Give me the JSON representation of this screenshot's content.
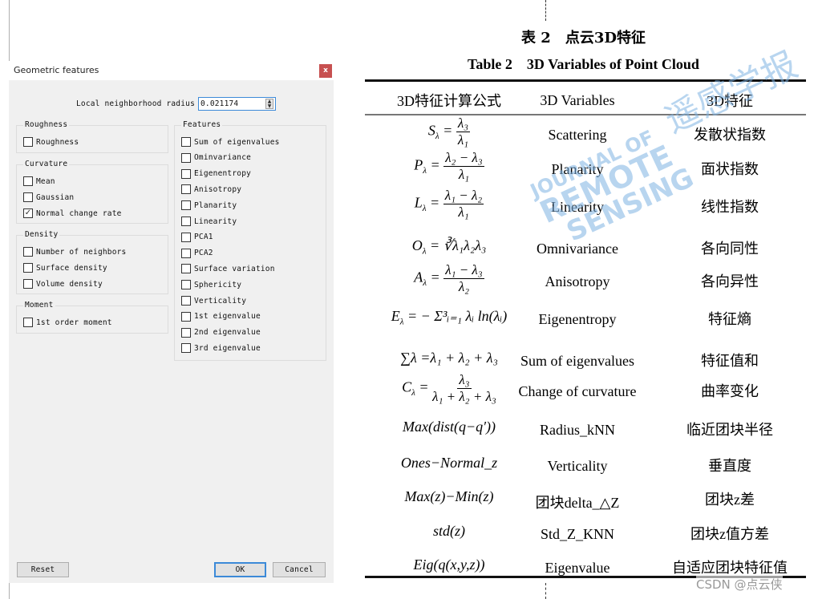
{
  "dialog": {
    "title": "Geometric features",
    "close_label": "x",
    "radius_label": "Local neighborhood radius",
    "radius_value": "0.021174",
    "groups": {
      "roughness": {
        "title": "Roughness",
        "items": [
          {
            "label": "Roughness",
            "checked": false
          }
        ]
      },
      "curvature": {
        "title": "Curvature",
        "items": [
          {
            "label": "Mean",
            "checked": false
          },
          {
            "label": "Gaussian",
            "checked": false
          },
          {
            "label": "Normal change rate",
            "checked": true
          }
        ]
      },
      "density": {
        "title": "Density",
        "items": [
          {
            "label": "Number of neighbors",
            "checked": false
          },
          {
            "label": "Surface density",
            "checked": false
          },
          {
            "label": "Volume density",
            "checked": false
          }
        ]
      },
      "moment": {
        "title": "Moment",
        "items": [
          {
            "label": "1st order moment",
            "checked": false
          }
        ]
      },
      "features": {
        "title": "Features",
        "items": [
          {
            "label": "Sum of eigenvalues",
            "checked": false
          },
          {
            "label": "Ominvariance",
            "checked": false
          },
          {
            "label": "Eigenentropy",
            "checked": false
          },
          {
            "label": "Anisotropy",
            "checked": false
          },
          {
            "label": "Planarity",
            "checked": false
          },
          {
            "label": "Linearity",
            "checked": false
          },
          {
            "label": "PCA1",
            "checked": false
          },
          {
            "label": "PCA2",
            "checked": false
          },
          {
            "label": "Surface variation",
            "checked": false
          },
          {
            "label": "Sphericity",
            "checked": false
          },
          {
            "label": "Verticality",
            "checked": false
          },
          {
            "label": "1st eigenvalue",
            "checked": false
          },
          {
            "label": "2nd eigenvalue",
            "checked": false
          },
          {
            "label": "3rd eigenvalue",
            "checked": false
          }
        ]
      }
    },
    "buttons": {
      "reset": "Reset",
      "ok": "OK",
      "cancel": "Cancel"
    }
  },
  "table": {
    "title_cn": "表 2　点云3D特征",
    "title_en": "Table 2　3D Variables of Point Cloud",
    "headers": [
      "3D特征计算公式",
      "3D Variables",
      "3D特征"
    ],
    "rows": [
      {
        "formula": "S_λ = λ3 / λ1",
        "f_lhs": "S",
        "f_num": "λ₃",
        "f_den": "λ₁",
        "variable": "Scattering",
        "cn": "发散状指数"
      },
      {
        "formula": "P_λ = (λ2 − λ3) / λ1",
        "f_lhs": "P",
        "f_num": "λ₂ − λ₃",
        "f_den": "λ₁",
        "variable": "Planarity",
        "cn": "面状指数"
      },
      {
        "formula": "L_λ = (λ1 − λ2) / λ1",
        "f_lhs": "L",
        "f_num": "λ₁ − λ₂",
        "f_den": "λ₁",
        "variable": "Linearity",
        "cn": "线性指数"
      },
      {
        "formula": "O_λ = ∛(λ1λ2λ3)",
        "f_text": "O",
        "f_rhs": "∛λ₁λ₂λ₃",
        "variable": "Omnivariance",
        "cn": "各向同性"
      },
      {
        "formula": "A_λ = (λ1 − λ3) / λ2",
        "f_lhs": "A",
        "f_num": "λ₁ − λ₃",
        "f_den": "λ₂",
        "variable": "Anisotropy",
        "cn": "各向异性"
      },
      {
        "formula": "E_λ = −Σ_{i=1}^{3} λi ln(λi)",
        "f_text": "E",
        "f_rhs": "− Σ³ᵢ₌₁ λᵢ ln(λᵢ)",
        "variable": "Eigenentropy",
        "cn": "特征熵"
      },
      {
        "formula": "Σλ = λ1 + λ2 + λ3",
        "f_plain": "∑λ =λ₁ + λ₂ + λ₃",
        "variable": "Sum of eigenvalues",
        "cn": "特征值和"
      },
      {
        "formula": "C_λ = λ3 / (λ1 + λ2 + λ3)",
        "f_lhs": "C",
        "f_num": "λ₃",
        "f_den": "λ₁ + λ₂ + λ₃",
        "variable": "Change of curvature",
        "cn": "曲率变化"
      },
      {
        "formula": "Max(dist(q − q'))",
        "f_plain": "Max(dist(q−q′))",
        "variable": "Radius_kNN",
        "cn": "临近团块半径"
      },
      {
        "formula": "Ones − Normal_z",
        "f_plain": "Ones−Normal_z",
        "variable": "Verticality",
        "cn": "垂直度"
      },
      {
        "formula": "Max(z) − Min(z)",
        "f_plain": "Max(z)−Min(z)",
        "variable": "团块delta_△Z",
        "cn": "团块z差"
      },
      {
        "formula": "std(z)",
        "f_plain": "std(z)",
        "variable": "Std_Z_KNN",
        "cn": "团块z值方差"
      },
      {
        "formula": "Eig(q(x,y,z))",
        "f_plain": "Eig(q(x,y,z))",
        "variable": "Eigenvalue",
        "cn": "自适应团块特征值"
      }
    ]
  },
  "watermark": {
    "line1": "JOURNAL OF",
    "line2": "REMOTE",
    "line3": "SENSING",
    "cn": "遥感学报"
  },
  "credit": "CSDN @点云侠",
  "colors": {
    "accent": "#3c8ad8",
    "close": "#c75050",
    "dialog_bg": "#f0f0f0",
    "watermark": "#7fb3e3"
  }
}
